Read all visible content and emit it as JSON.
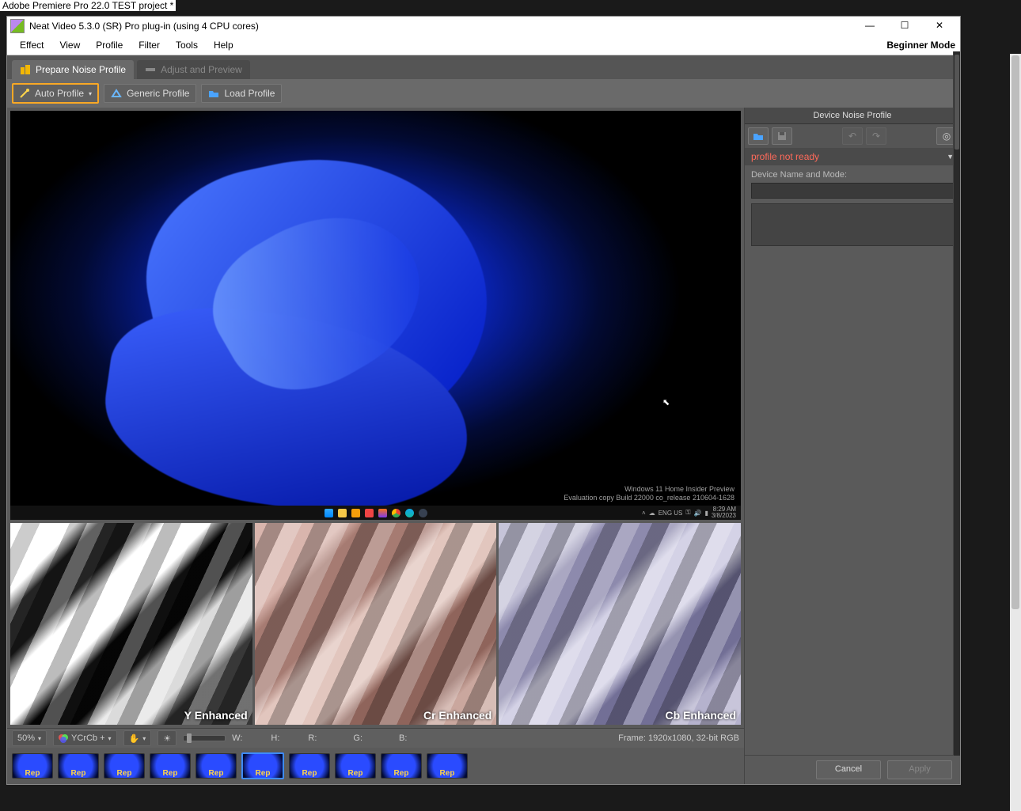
{
  "bg_title": "Adobe Premiere Pro 22.0 TEST project *",
  "window": {
    "title": "Neat Video 5.3.0 (SR) Pro plug-in (using 4 CPU cores)"
  },
  "menu": {
    "items": [
      "Effect",
      "View",
      "Profile",
      "Filter",
      "Tools",
      "Help"
    ],
    "mode": "Beginner Mode"
  },
  "tabs": {
    "t0": "Prepare Noise Profile",
    "t1": "Adjust and Preview"
  },
  "toolbar": {
    "auto": "Auto Profile",
    "generic": "Generic Profile",
    "load": "Load Profile"
  },
  "watermark": {
    "line1": "Windows 11 Home Insider Preview",
    "line2": "Evaluation copy Build 22000 co_release 210604-1628"
  },
  "sys_time": "8:29 AM",
  "sys_date": "3/8/2023",
  "sys_lang": "ENG US",
  "channels": {
    "y": "Y Enhanced",
    "cr": "Cr Enhanced",
    "cb": "Cb Enhanced"
  },
  "status": {
    "zoom": "50%",
    "space": "YCrCb +",
    "w_label": "W:",
    "h_label": "H:",
    "r_label": "R:",
    "g_label": "G:",
    "b_label": "B:",
    "frame_info": "Frame:  1920x1080, 32-bit RGB"
  },
  "thumbs": {
    "label": "Rep",
    "count": 10,
    "selected_index": 5
  },
  "right": {
    "header": "Device Noise Profile",
    "status": "profile not ready",
    "device_label": "Device Name and Mode:"
  },
  "buttons": {
    "cancel": "Cancel",
    "apply": "Apply"
  }
}
